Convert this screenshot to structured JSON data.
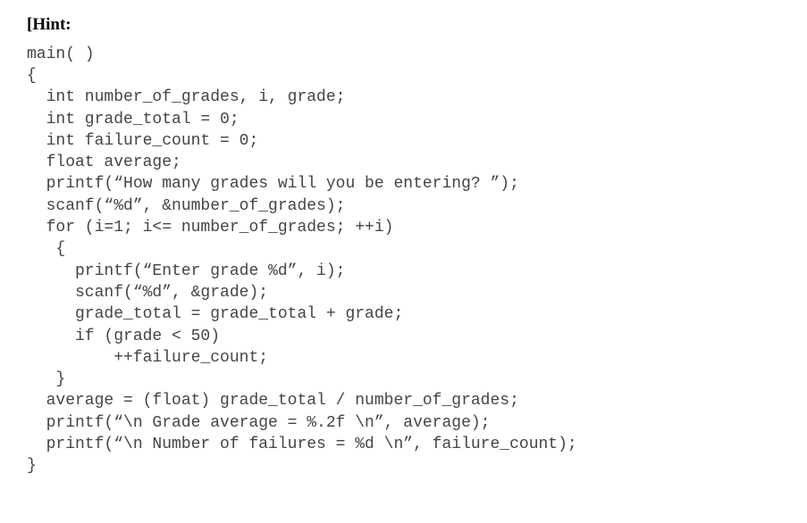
{
  "hint_label": "[Hint:",
  "code": {
    "l01": "main( )",
    "l02": "{",
    "l03": "  int number_of_grades, i, grade;",
    "l04": "  int grade_total = 0;",
    "l05": "  int failure_count = 0;",
    "l06": "  float average;",
    "l07": "  printf(“How many grades will you be entering? ”);",
    "l08": "  scanf(“%d”, &number_of_grades);",
    "l09": "  for (i=1; i<= number_of_grades; ++i)",
    "l10": "   {",
    "l11": "     printf(“Enter grade %d”, i);",
    "l12": "     scanf(“%d”, &grade);",
    "l13": "     grade_total = grade_total + grade;",
    "l14": "     if (grade < 50)",
    "l15": "         ++failure_count;",
    "l16": "   }",
    "l17": "  average = (float) grade_total / number_of_grades;",
    "l18": "  printf(“\\n Grade average = %.2f \\n”, average);",
    "l19": "  printf(“\\n Number of failures = %d \\n”, failure_count);",
    "l20": "}"
  }
}
